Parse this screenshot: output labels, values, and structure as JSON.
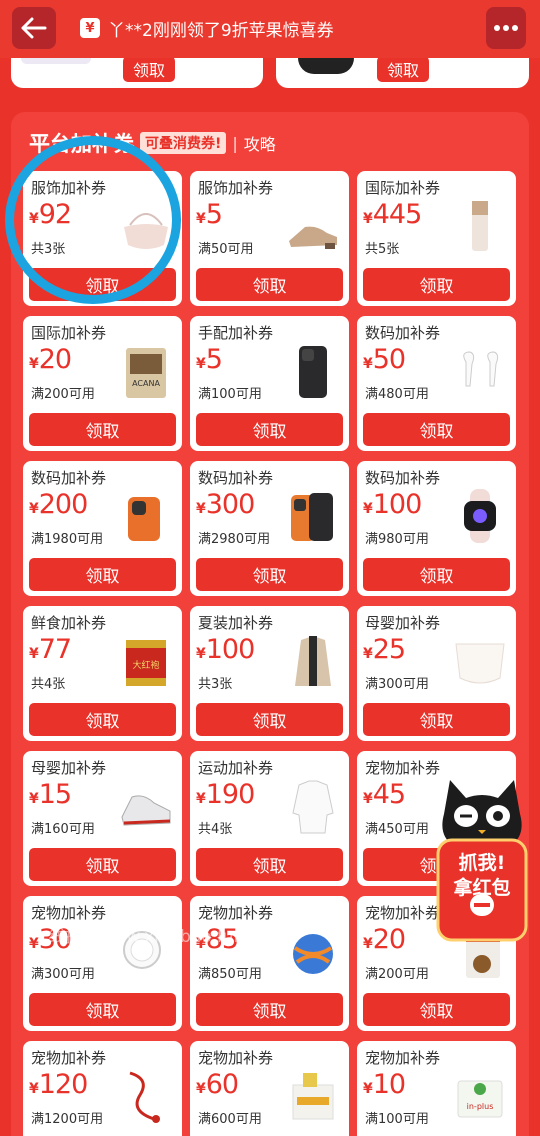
{
  "topbar": {
    "ticker_text": "丫**2刚刚领了9折苹果惊喜券",
    "ticker_icon": "¥",
    "back_icon": "back-arrow-icon",
    "more_icon": "more-dots-icon"
  },
  "prev_section": {
    "claim_label": "领取"
  },
  "section": {
    "title": "平台加补券",
    "badge": "可叠消费券!",
    "divider": "|",
    "guide": "攻略"
  },
  "coupons": [
    {
      "name": "服饰加补券",
      "amount": "92",
      "cond": "共3张",
      "btn": "领取",
      "thumb": "handbag"
    },
    {
      "name": "服饰加补券",
      "amount": "5",
      "cond": "满50可用",
      "btn": "领取",
      "thumb": "shoe"
    },
    {
      "name": "国际加补券",
      "amount": "445",
      "cond": "共5张",
      "btn": "领取",
      "thumb": "cosmetic"
    },
    {
      "name": "国际加补券",
      "amount": "20",
      "cond": "满200可用",
      "btn": "领取",
      "thumb": "petfood"
    },
    {
      "name": "手配加补券",
      "amount": "5",
      "cond": "满100可用",
      "btn": "领取",
      "thumb": "phone-black"
    },
    {
      "name": "数码加补券",
      "amount": "50",
      "cond": "满480可用",
      "btn": "领取",
      "thumb": "earbuds"
    },
    {
      "name": "数码加补券",
      "amount": "200",
      "cond": "满1980可用",
      "btn": "领取",
      "thumb": "phone-orange"
    },
    {
      "name": "数码加补券",
      "amount": "300",
      "cond": "满2980可用",
      "btn": "领取",
      "thumb": "phone-orange2"
    },
    {
      "name": "数码加补券",
      "amount": "100",
      "cond": "满980可用",
      "btn": "领取",
      "thumb": "watch"
    },
    {
      "name": "鲜食加补券",
      "amount": "77",
      "cond": "共4张",
      "btn": "领取",
      "thumb": "tea-can"
    },
    {
      "name": "夏装加补券",
      "amount": "100",
      "cond": "共3张",
      "btn": "领取",
      "thumb": "coat"
    },
    {
      "name": "母婴加补券",
      "amount": "25",
      "cond": "满300可用",
      "btn": "领取",
      "thumb": "diaper"
    },
    {
      "name": "母婴加补券",
      "amount": "15",
      "cond": "满160可用",
      "btn": "领取",
      "thumb": "sneaker"
    },
    {
      "name": "运动加补券",
      "amount": "190",
      "cond": "共4张",
      "btn": "领取",
      "thumb": "shirt"
    },
    {
      "name": "宠物加补券",
      "amount": "45",
      "cond": "满450可用",
      "btn": "领取",
      "thumb": "none"
    },
    {
      "name": "宠物加补券",
      "amount": "30",
      "cond": "满300可用",
      "btn": "领取",
      "thumb": "bowl"
    },
    {
      "name": "宠物加补券",
      "amount": "85",
      "cond": "满850可用",
      "btn": "领取",
      "thumb": "ball"
    },
    {
      "name": "宠物加补券",
      "amount": "20",
      "cond": "满200可用",
      "btn": "领取",
      "thumb": "petfood2"
    },
    {
      "name": "宠物加补券",
      "amount": "120",
      "cond": "满1200可用",
      "btn": "领取",
      "thumb": "leash"
    },
    {
      "name": "宠物加补券",
      "amount": "60",
      "cond": "满600可用",
      "btn": "领取",
      "thumb": "supplement"
    },
    {
      "name": "宠物加补券",
      "amount": "10",
      "cond": "满100可用",
      "btn": "领取",
      "thumb": "catfood"
    }
  ],
  "currency": "¥",
  "float_widget": {
    "line1": "抓我!",
    "line2": "拿红包",
    "icon": "tmall-cat-icon"
  },
  "watermark": "线报酷-new.xianbao.fun",
  "colors": {
    "brand_red": "#e8322a",
    "annotation_blue": "#1ba4e0"
  }
}
